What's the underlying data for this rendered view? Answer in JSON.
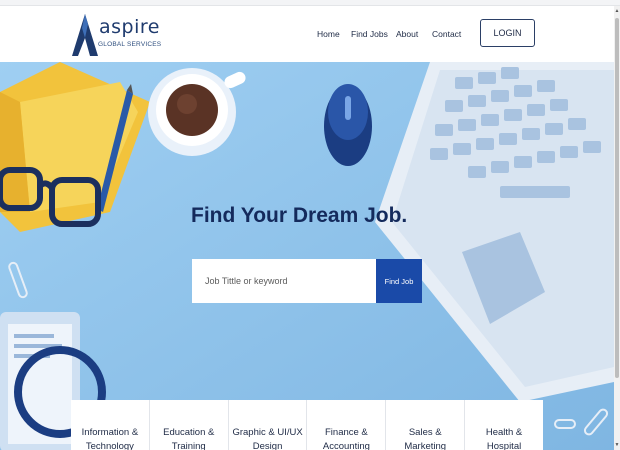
{
  "brand": {
    "name": "aspire",
    "tagline": "GLOBAL SERVICES"
  },
  "nav": {
    "home": "Home",
    "find_jobs": "Find Jobs",
    "about": "About",
    "contact": "Contact",
    "login": "LOGIN"
  },
  "hero": {
    "title": "Find Your Dream Job.",
    "search_placeholder": "Job Tittle or keyword",
    "search_button": "Find Job"
  },
  "categories": [
    {
      "line1": "Information &",
      "line2": "Technology"
    },
    {
      "line1": "Education &",
      "line2": "Training"
    },
    {
      "line1": "Graphic & UI/UX",
      "line2": "Design"
    },
    {
      "line1": "Finance &",
      "line2": "Accounting"
    },
    {
      "line1": "Sales &",
      "line2": "Marketing"
    },
    {
      "line1": "Health &",
      "line2": "Hospital"
    }
  ],
  "colors": {
    "navy": "#142a5c",
    "button_blue": "#1a4aa8",
    "hero_bg": "#8ec3ea"
  }
}
